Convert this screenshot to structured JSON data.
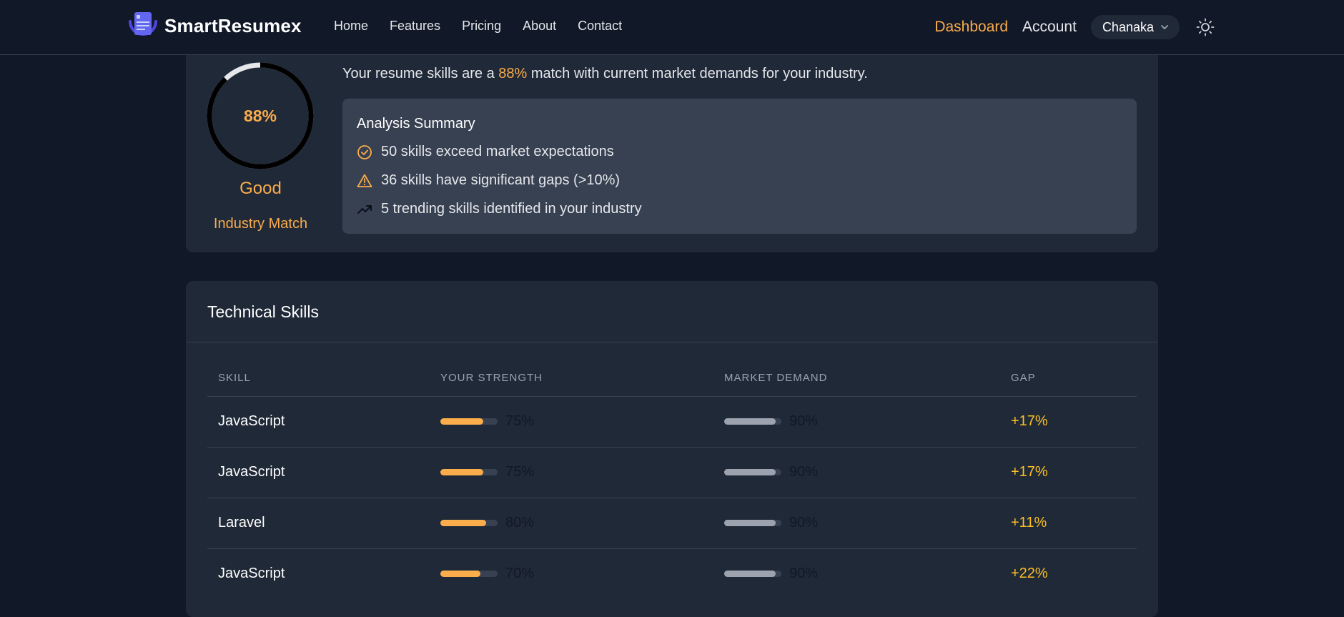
{
  "nav": {
    "brand": "SmartResumex",
    "links": [
      "Home",
      "Features",
      "Pricing",
      "About",
      "Contact"
    ],
    "dashboard": "Dashboard",
    "account": "Account",
    "user": "Chanaka"
  },
  "overview": {
    "score": "88%",
    "score_value": 88,
    "rating": "Good",
    "caption": "Industry Match",
    "match_prefix": "Your resume skills are a ",
    "match_pct": "88%",
    "match_suffix": " match with current market demands for your industry."
  },
  "summary": {
    "title": "Analysis Summary",
    "items": [
      {
        "icon": "check-circle-icon",
        "text": "50 skills exceed market expectations"
      },
      {
        "icon": "warning-icon",
        "text": "36 skills have significant gaps (>10%)"
      },
      {
        "icon": "trending-up-icon",
        "text": "5 trending skills identified in your industry"
      }
    ]
  },
  "skills": {
    "title": "Technical Skills",
    "headers": [
      "SKILL",
      "YOUR STRENGTH",
      "MARKET DEMAND",
      "GAP"
    ],
    "rows": [
      {
        "skill": "JavaScript",
        "strength": "75%",
        "strength_value": 75,
        "demand": "90%",
        "demand_value": 90,
        "gap": "+17%"
      },
      {
        "skill": "JavaScript",
        "strength": "75%",
        "strength_value": 75,
        "demand": "90%",
        "demand_value": 90,
        "gap": "+17%"
      },
      {
        "skill": "Laravel",
        "strength": "80%",
        "strength_value": 80,
        "demand": "90%",
        "demand_value": 90,
        "gap": "+11%"
      },
      {
        "skill": "JavaScript",
        "strength": "70%",
        "strength_value": 70,
        "demand": "90%",
        "demand_value": 90,
        "gap": "+22%"
      }
    ]
  },
  "colors": {
    "accent": "#fbac4b",
    "gap": "#fbbf24",
    "page_bg": "#111827",
    "card_bg": "#1f2937",
    "panel_bg": "#374151"
  }
}
